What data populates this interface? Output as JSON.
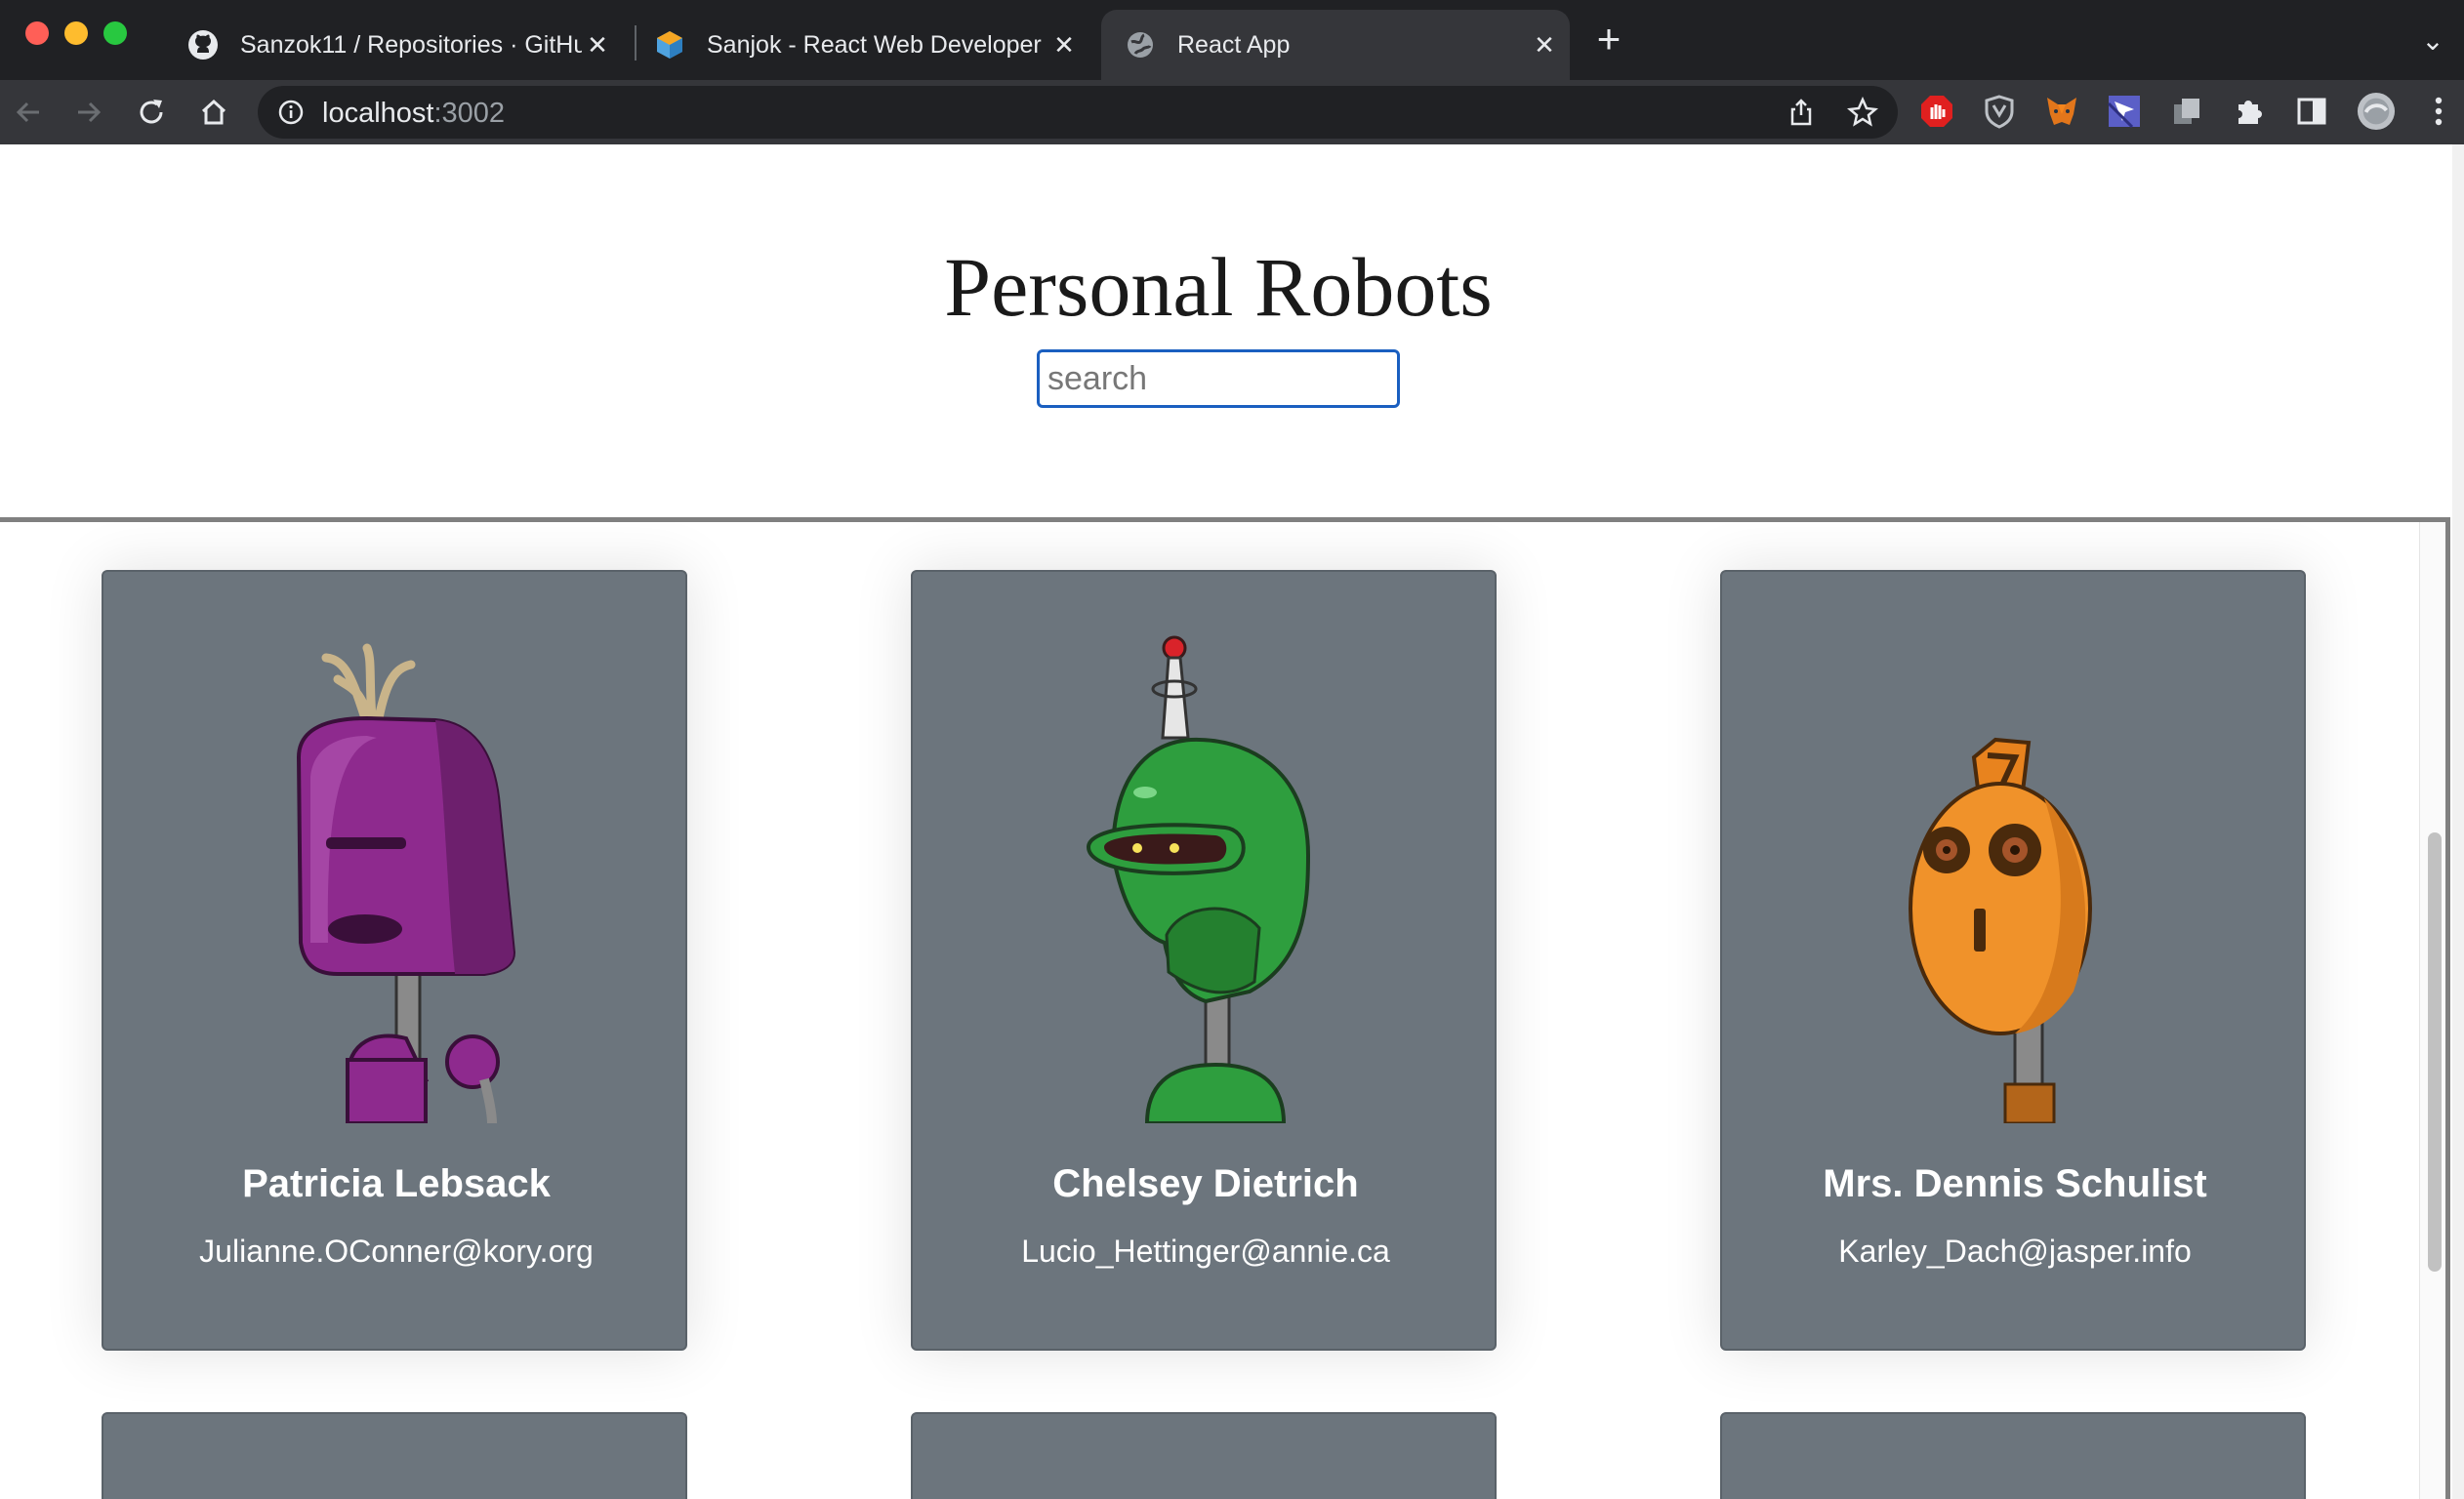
{
  "browser": {
    "tabs": [
      {
        "title": "Sanzok11 / Repositories · GitHub",
        "icon": "github-icon",
        "active": false
      },
      {
        "title": "Sanjok - React Web Developer",
        "icon": "hexagon-icon",
        "active": false
      },
      {
        "title": "React App",
        "icon": "globe-icon",
        "active": true
      }
    ],
    "new_tab_label": "+",
    "url_host": "localhost",
    "url_port": ":3002",
    "extensions": [
      "adblock-icon",
      "shield-icon",
      "fox-icon",
      "cursor-icon",
      "copy-icon",
      "puzzle-icon",
      "sidebar-icon",
      "profile-avatar"
    ]
  },
  "page": {
    "title": "Personal Robots",
    "search": {
      "placeholder": "search",
      "value": ""
    }
  },
  "robots": [
    {
      "name": "Patricia Lebsack",
      "email": "Julianne.OConner@kory.org",
      "color": "#8e2a8e"
    },
    {
      "name": "Chelsey Dietrich",
      "email": "Lucio_Hettinger@annie.ca",
      "color": "#2e9e3e"
    },
    {
      "name": "Mrs. Dennis Schulist",
      "email": "Karley_Dach@jasper.info",
      "color": "#f0922a"
    }
  ],
  "colors": {
    "card_bg": "#6c757d",
    "search_border": "#1a5fc0",
    "chrome_dark": "#202124",
    "chrome_toolbar": "#35363a"
  }
}
